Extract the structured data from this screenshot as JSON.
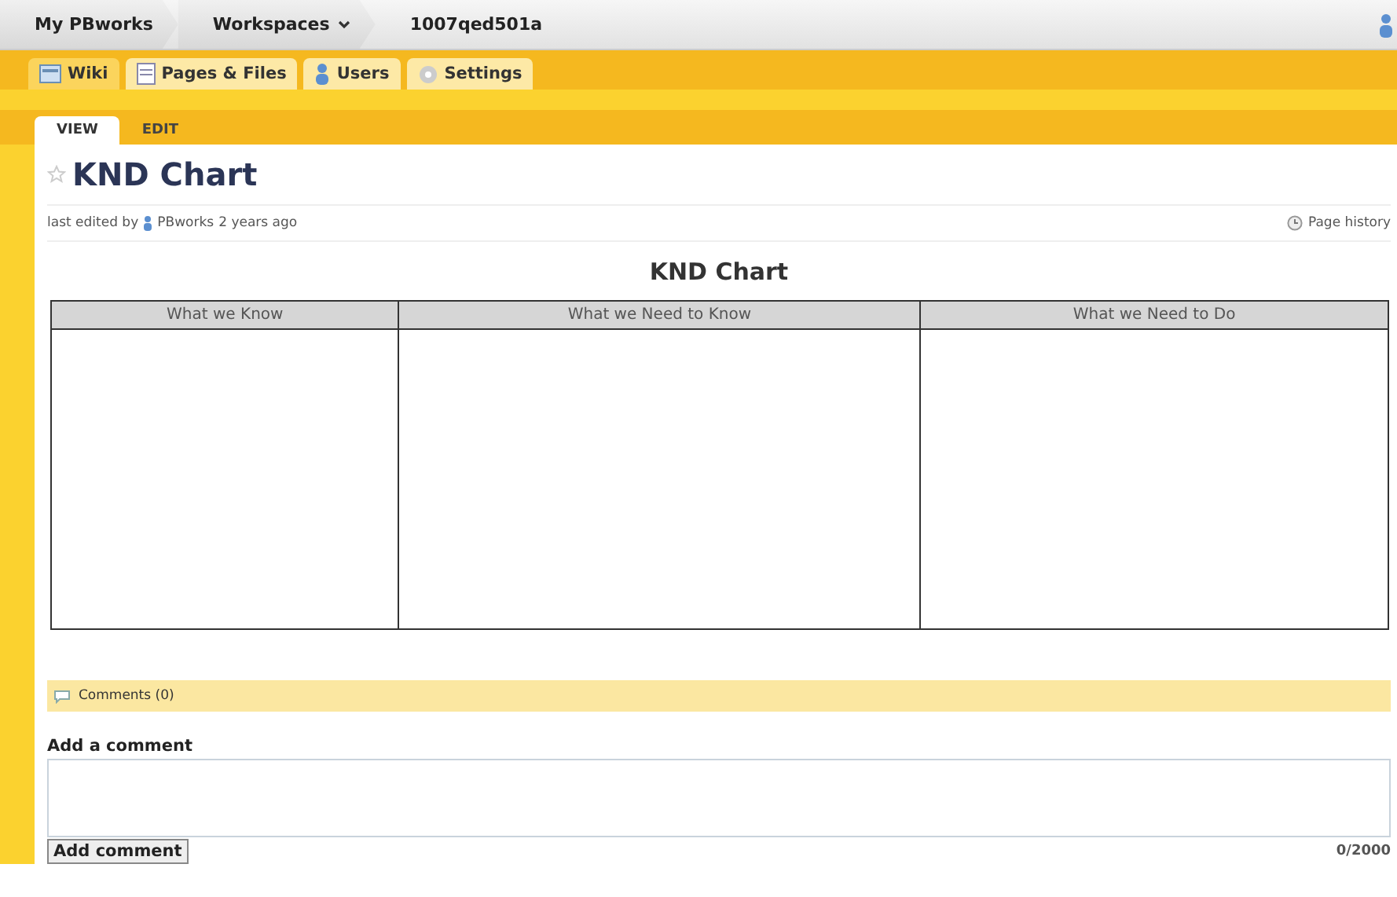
{
  "breadcrumbs": [
    {
      "label": "My PBworks",
      "dropdown": false
    },
    {
      "label": "Workspaces",
      "dropdown": true
    },
    {
      "label": "1007qed501a",
      "dropdown": false
    }
  ],
  "nav_tabs": [
    {
      "label": "Wiki",
      "kind": "wiki",
      "selected": true
    },
    {
      "label": "Pages & Files",
      "kind": "pages",
      "selected": false
    },
    {
      "label": "Users",
      "kind": "users",
      "selected": false
    },
    {
      "label": "Settings",
      "kind": "settings",
      "selected": false
    }
  ],
  "page_tabs": [
    {
      "label": "VIEW",
      "selected": true
    },
    {
      "label": "EDIT",
      "selected": false
    }
  ],
  "page": {
    "title": "KND Chart",
    "meta_prefix": "last edited by",
    "meta_author": "PBworks",
    "meta_suffix": "2 years ago",
    "history_link": "Page history"
  },
  "content": {
    "heading": "KND Chart",
    "columns": [
      "What we Know",
      "What we Need to Know",
      "What we Need to Do"
    ]
  },
  "comments": {
    "header": "Comments (0)",
    "add_label": "Add a comment",
    "button": "Add comment",
    "counter": "0/2000"
  }
}
